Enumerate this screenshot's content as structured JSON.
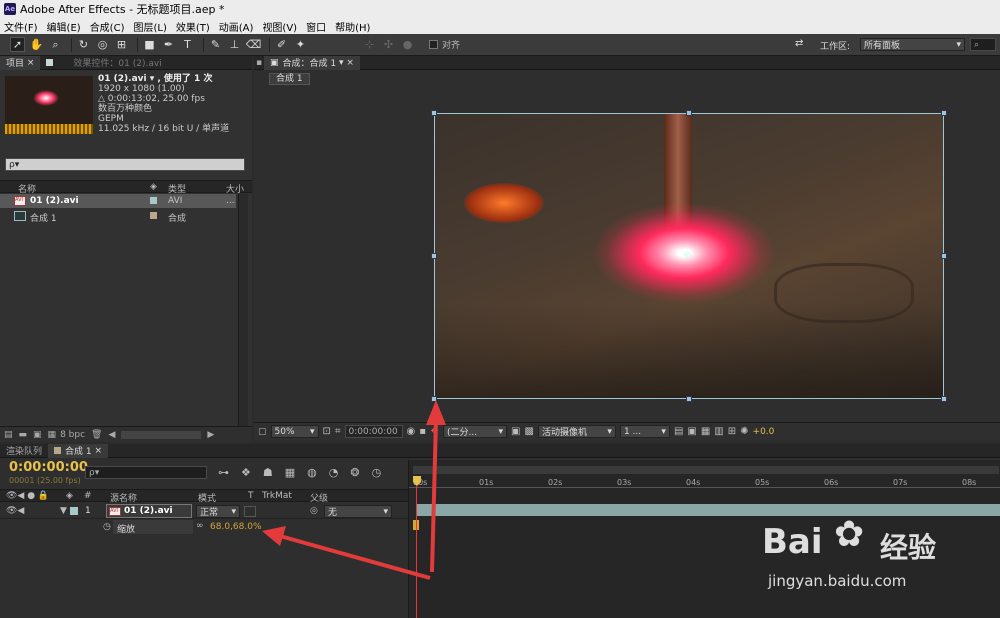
{
  "app": {
    "logo": "Ae",
    "title": "Adobe After Effects - 无标题项目.aep *"
  },
  "menu": [
    "文件(F)",
    "编辑(E)",
    "合成(C)",
    "图层(L)",
    "效果(T)",
    "动画(A)",
    "视图(V)",
    "窗口",
    "帮助(H)"
  ],
  "toolbar": {
    "snap_label": "对齐",
    "workspace_label": "工作区:",
    "workspace_value": "所有面板"
  },
  "project_panel": {
    "tab_project": "项目",
    "tab_effects": "效果控件：01 (2).avi",
    "asset_name": "01 (2).avi ▾ , 使用了 1 次",
    "asset_res": "1920 x 1080 (1.00)",
    "asset_dur": "△ 0:00:13:02, 25.00 fps",
    "asset_colors": "数百万种颜色",
    "asset_codec": "GEPM",
    "asset_audio": "11.025 kHz / 16 bit U / 单声道",
    "search_placeholder": "ρ▾",
    "col_name": "名称",
    "col_type": "类型",
    "col_size": "大小",
    "items": [
      {
        "name": "01 (2).avi",
        "type": "AVI",
        "size": "...",
        "icon": "video-file-icon"
      },
      {
        "name": "合成 1",
        "type": "合成",
        "size": "",
        "icon": "composition-icon"
      }
    ],
    "bpc": "8 bpc"
  },
  "comp_panel": {
    "tab_label": "合成：合成 1",
    "crumb": "合成 1",
    "zoom": "50%",
    "timecode": "0:00:00:00",
    "resolution": "(二分...",
    "camera": "活动摄像机",
    "views": "1 ...",
    "exposure": "+0.0"
  },
  "timeline": {
    "tab_render": "渲染队列",
    "tab_comp": "合成 1",
    "current_time": "0:00:00:00",
    "frame_info": "00001 (25.00 fps)",
    "search_placeholder": "ρ▾",
    "col_num": "#",
    "col_source": "源名称",
    "col_mode": "模式",
    "col_t": "T",
    "col_trkmat": "TrkMat",
    "col_parent": "父级",
    "layer": {
      "num": "1",
      "name": "01 (2).avi",
      "mode": "正常",
      "parent": "无"
    },
    "property": {
      "name": "缩放",
      "value": "68.0,68.0%"
    },
    "ruler": [
      "00s",
      "01s",
      "02s",
      "03s",
      "04s",
      "05s",
      "06s",
      "07s",
      "08s"
    ]
  },
  "watermark": {
    "brand": "Bai",
    "brand2": "经验",
    "url": "jingyan.baidu.com"
  },
  "colors": {
    "accent_yellow": "#e8c24a",
    "arrow_red": "#e33b3b",
    "layer_bar": "#8aa7a7",
    "property_value": "#d6a43a"
  }
}
